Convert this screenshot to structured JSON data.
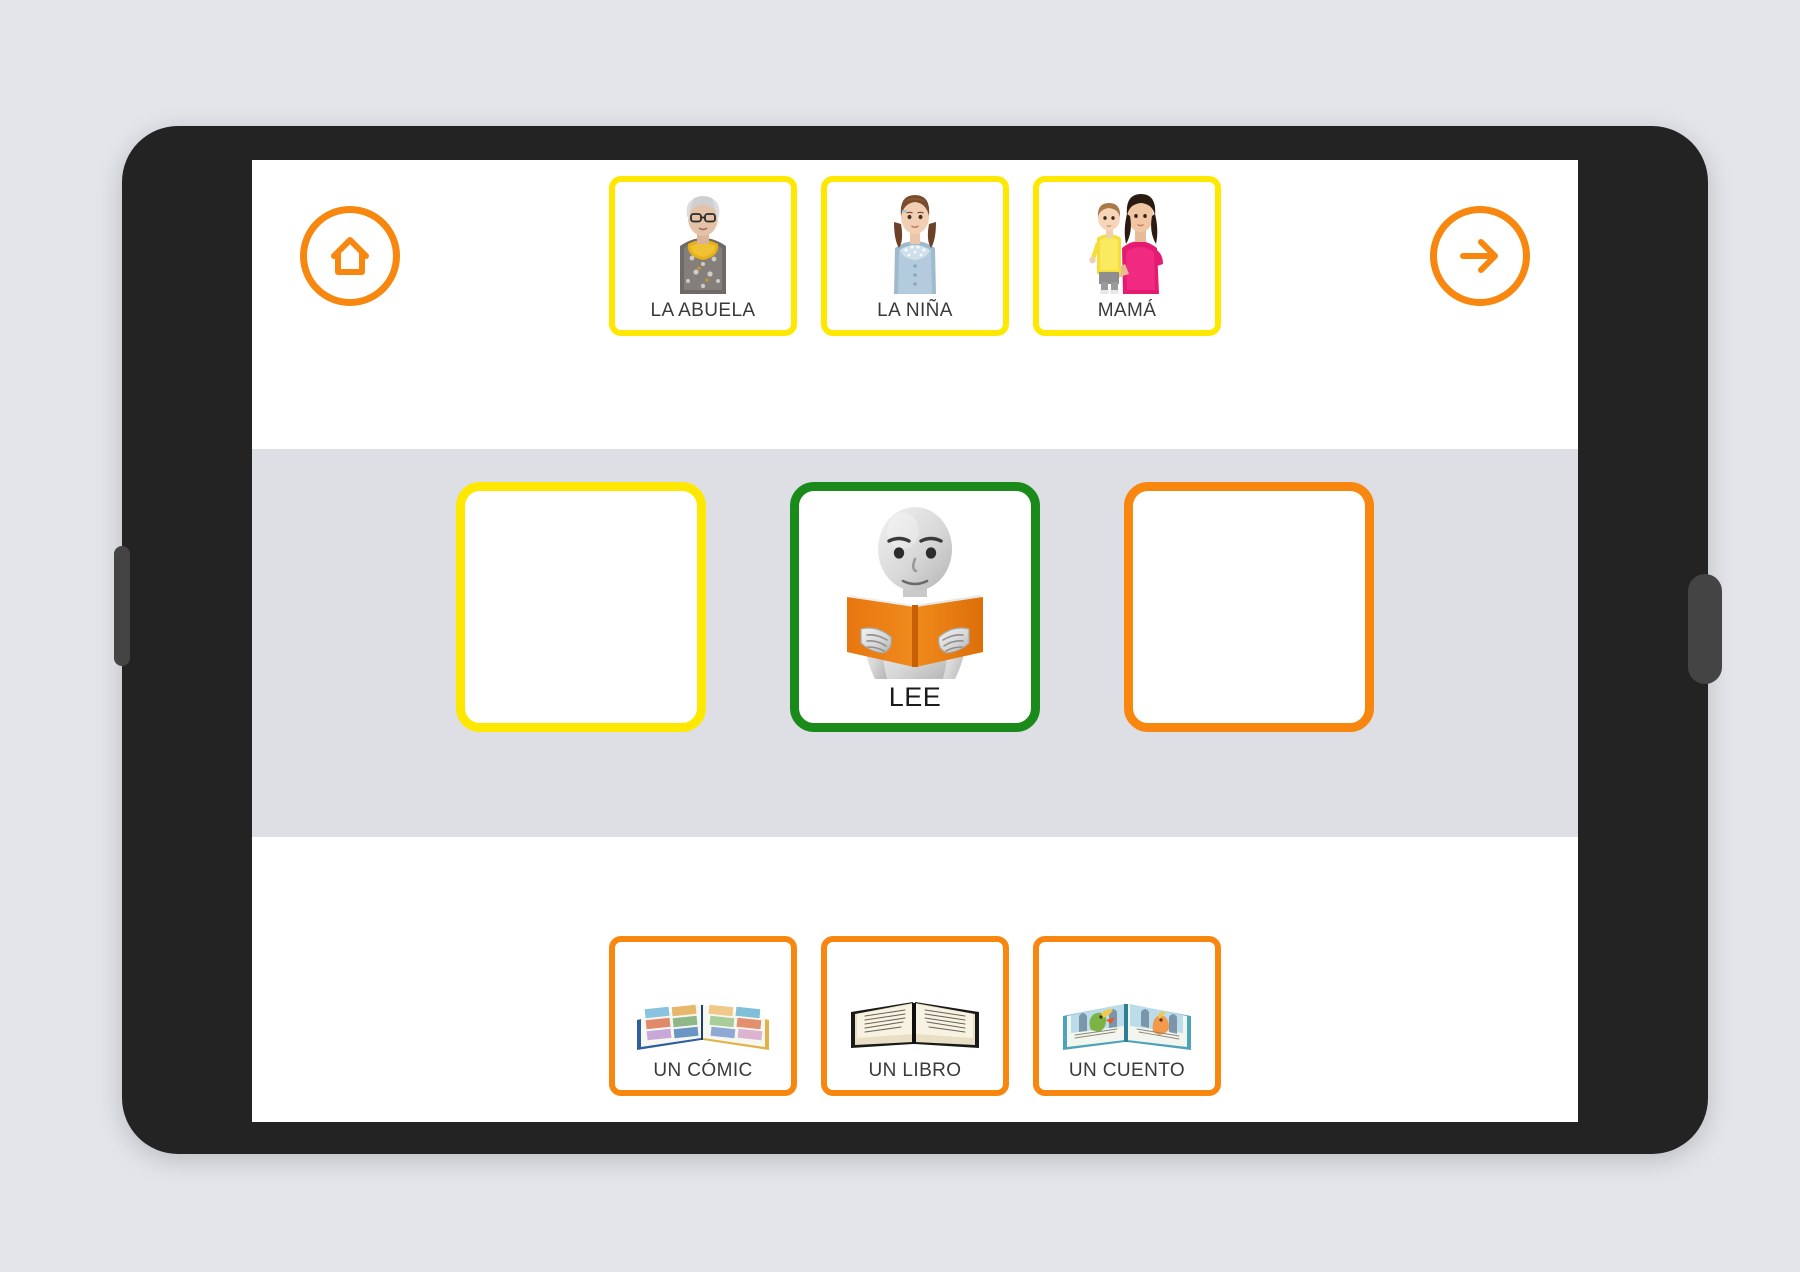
{
  "app": {
    "title": "Constructor de frases pictogramas",
    "device": "tablet"
  },
  "nav": {
    "home": {
      "label": "Inicio",
      "icon": "home-icon",
      "color": "#f7870f"
    },
    "next": {
      "label": "Siguiente",
      "icon": "arrow-right-icon",
      "color": "#f7870f"
    }
  },
  "colors": {
    "subject_border": "#ffe800",
    "verb_border": "#1a8a1a",
    "object_border": "#f7870f",
    "band_background": "#dddfe4",
    "screen_background": "#ffffff",
    "bezel": "#232323",
    "page_background": "#e3e5ea"
  },
  "subject_row": {
    "category": "sujeto",
    "border_color": "#ffe800",
    "cards": [
      {
        "label": "LA ABUELA",
        "art": "grandmother-photo"
      },
      {
        "label": "LA NIÑA",
        "art": "girl-photo"
      },
      {
        "label": "MAMÁ",
        "art": "mother-with-baby-photo"
      }
    ]
  },
  "sentence_row": {
    "slots": [
      {
        "state": "empty",
        "border_color": "#ffe800",
        "label": "",
        "art": "",
        "name": "subject-slot"
      },
      {
        "state": "filled",
        "border_color": "#1a8a1a",
        "label": "LEE",
        "art": "person-reading-book-pictogram",
        "name": "verb-slot"
      },
      {
        "state": "empty",
        "border_color": "#f7870f",
        "label": "",
        "art": "",
        "name": "object-slot"
      }
    ]
  },
  "object_row": {
    "category": "objeto",
    "border_color": "#f7870f",
    "cards": [
      {
        "label": "UN CÓMIC",
        "art": "open-comic-book-photo"
      },
      {
        "label": "UN LIBRO",
        "art": "open-text-book-photo"
      },
      {
        "label": "UN CUENTO",
        "art": "open-illustrated-storybook-photo"
      }
    ]
  }
}
